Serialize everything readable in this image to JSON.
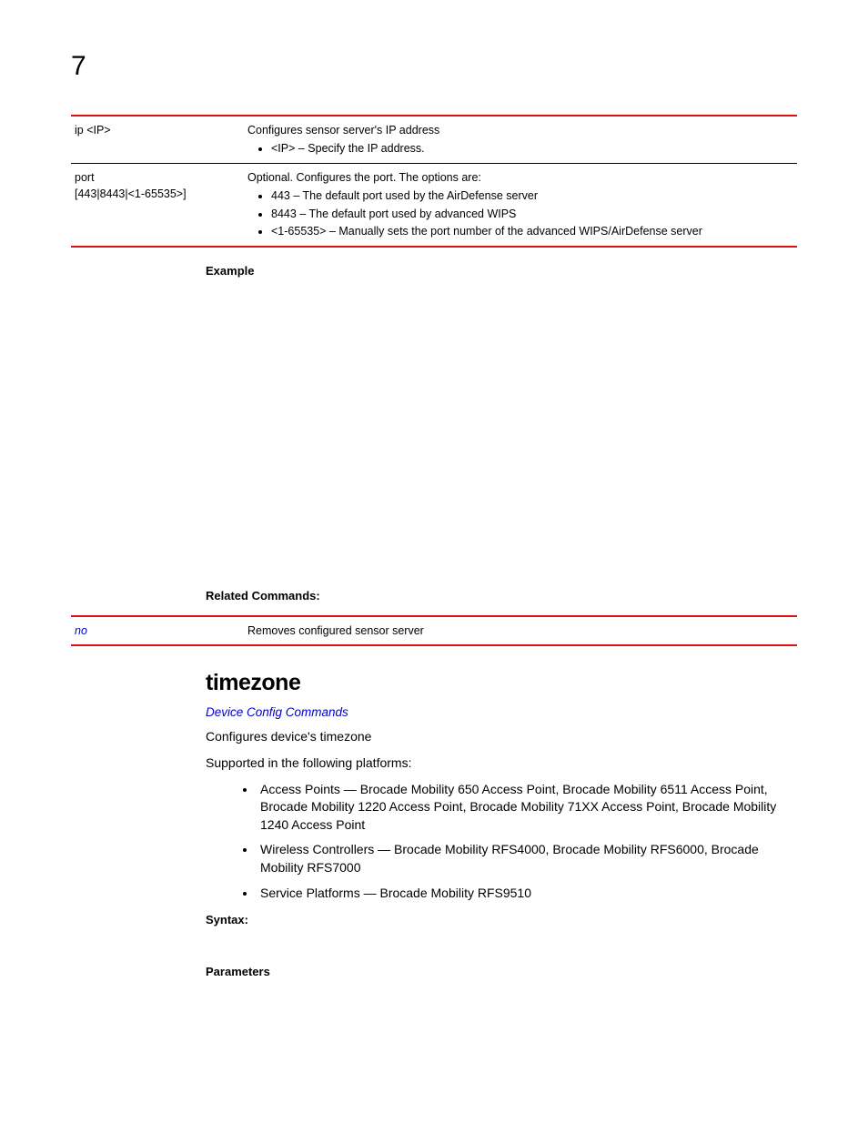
{
  "chapter_number": "7",
  "table_params": {
    "row1": {
      "left": "ip <IP>",
      "desc": "Configures sensor server's IP address",
      "bullets": [
        "<IP> – Specify the IP address."
      ]
    },
    "row2": {
      "left_line1": "port",
      "left_line2": "[443|8443|<1-65535>]",
      "desc": "Optional. Configures the port. The options are:",
      "bullets": [
        "443 – The default port used by the AirDefense server",
        "8443 – The default port used by advanced WIPS",
        "<1-65535> – Manually sets the port number of the advanced WIPS/AirDefense server"
      ]
    }
  },
  "labels": {
    "example": "Example",
    "related": "Related Commands:",
    "syntax": "Syntax:",
    "parameters": "Parameters"
  },
  "related_table": {
    "left": "no",
    "right": "Removes configured sensor server"
  },
  "section": {
    "title": "timezone",
    "link": "Device Config Commands",
    "p1": "Configures device's timezone",
    "p2": "Supported in the following platforms:",
    "platforms": [
      "Access Points — Brocade Mobility 650 Access Point, Brocade Mobility 6511 Access Point, Brocade Mobility 1220 Access Point, Brocade Mobility 71XX Access Point, Brocade Mobility 1240 Access Point",
      "Wireless Controllers — Brocade Mobility RFS4000, Brocade Mobility RFS6000, Brocade Mobility RFS7000",
      "Service Platforms — Brocade Mobility RFS9510"
    ]
  }
}
